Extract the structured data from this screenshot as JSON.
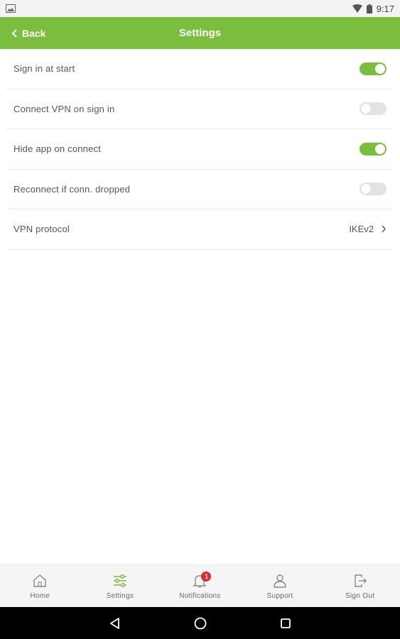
{
  "status_bar": {
    "time": "9:17",
    "icons": [
      "image-icon",
      "wifi-icon",
      "battery-icon"
    ]
  },
  "header": {
    "back_label": "Back",
    "title": "Settings",
    "color": "#7bbd3d"
  },
  "settings": [
    {
      "label": "Sign in at start",
      "type": "toggle",
      "state": "on"
    },
    {
      "label": "Connect VPN on sign in",
      "type": "toggle",
      "state": "off"
    },
    {
      "label": "Hide app on connect",
      "type": "toggle",
      "state": "on"
    },
    {
      "label": "Reconnect if conn. dropped",
      "type": "toggle",
      "state": "off"
    },
    {
      "label": "VPN protocol",
      "type": "select",
      "value": "IKEv2"
    }
  ],
  "bottom_nav": {
    "items": [
      {
        "label": "Home",
        "icon": "home-icon"
      },
      {
        "label": "Settings",
        "icon": "sliders-icon",
        "active": true
      },
      {
        "label": "Notifications",
        "icon": "bell-icon",
        "badge": "1"
      },
      {
        "label": "Support",
        "icon": "person-icon"
      },
      {
        "label": "Sign Out",
        "icon": "sign-out-icon"
      }
    ]
  },
  "colors": {
    "accent": "#7bbd3d",
    "badge": "#e02929"
  }
}
